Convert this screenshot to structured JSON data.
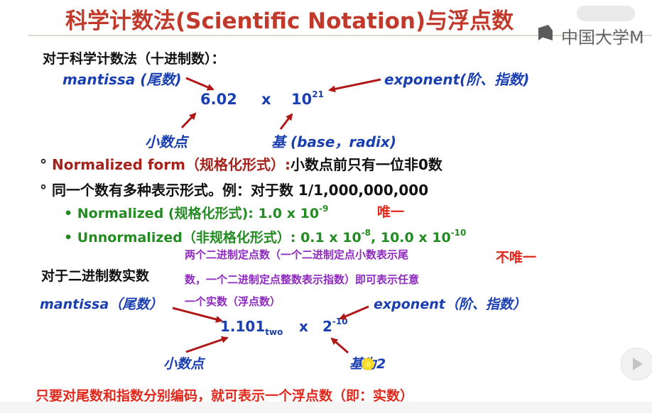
{
  "title": "科学计数法(Scientific Notation)与浮点数",
  "watermark": "中国大学M",
  "decimal_section": {
    "heading": "对于科学计数法（十进制数）：",
    "mantissa_label": "mantissa (尾数)",
    "exponent_label": "exponent(阶、指数)",
    "number_mantissa": "6.02",
    "times": "x",
    "base_value": "10",
    "exponent_value": "21",
    "point_label": "小数点",
    "base_label": "基 (base，radix)"
  },
  "bullets": {
    "normalized_form_term": "Normalized form（规格化形式）:",
    "normalized_form_desc": "小数点前只有一位非0数",
    "multi_repr": "同一个数有多种表示形式。例：对于数 1/1,000,000,000",
    "normalized_example_label": "Normalized (规格化形式): 1.0 x 10",
    "normalized_example_exp": "-9",
    "unique": "唯一",
    "unnormalized_label": "Unnormalized（非规格化形式）: 0.1 x 10",
    "unnormalized_exp1": "-8",
    "unnormalized_mid": ", 10.0 x 10",
    "unnormalized_exp2": "-10",
    "not_unique": "不唯一"
  },
  "annotation": {
    "line1": "两个二进制定点数（一个二进制定点小数表示尾",
    "line2": "数，一个二进制定点整数表示指数）即可表示任意",
    "line3": "一个实数（浮点数）"
  },
  "binary_section": {
    "heading": "对于二进制数实数",
    "mantissa_label": "mantissa（尾数）",
    "exponent_label": "exponent（阶、指数）",
    "number_mantissa": "1.101",
    "mantissa_subscript": "two",
    "times": "x",
    "base_value": "2",
    "exponent_value": "-10",
    "point_label": "小数点",
    "base_label": "基为2"
  },
  "conclusion": "只要对尾数和指数分别编码，就可表示一个浮点数（即：实数）",
  "bullet_glyph": "°",
  "dot_glyph": "•",
  "colors": {
    "title": "#c0392b",
    "blue": "#1a3fb0",
    "dark_red": "#a5231d",
    "green": "#238b22",
    "red": "#e0281c",
    "purple": "#8e2bbf",
    "arrow": "#b01818"
  }
}
